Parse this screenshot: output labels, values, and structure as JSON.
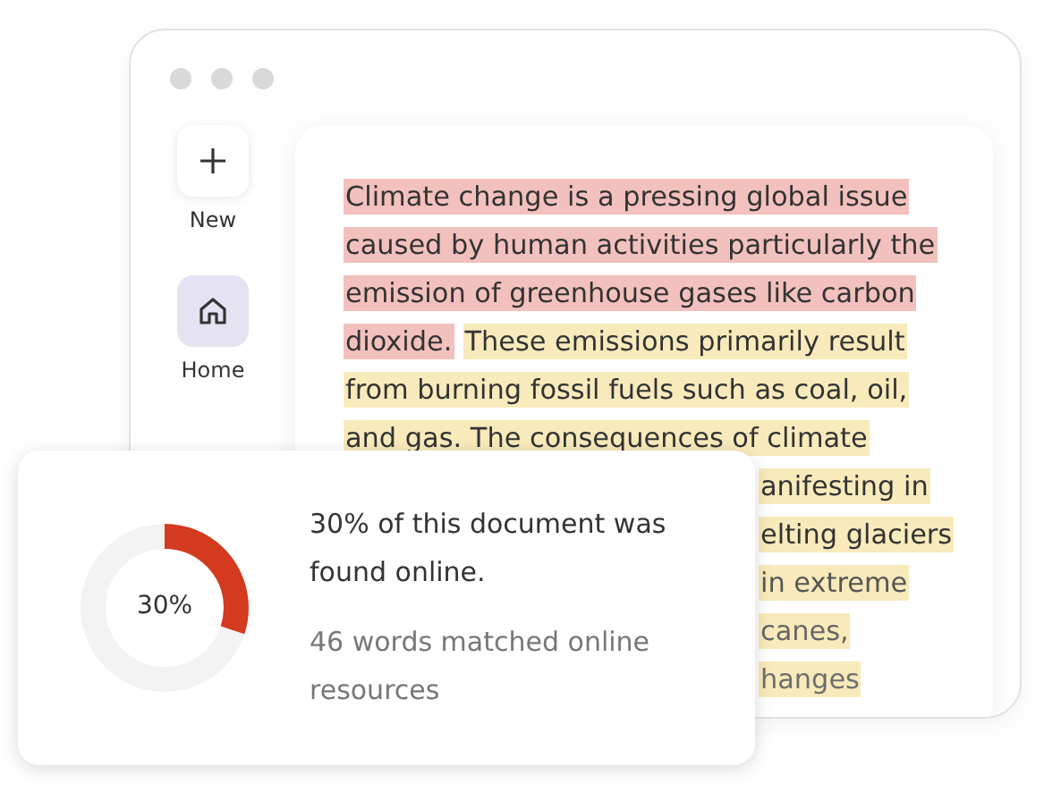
{
  "sidebar": {
    "items": [
      {
        "kind": "new",
        "label": "New",
        "selected": false
      },
      {
        "kind": "home",
        "label": "Home",
        "selected": true
      }
    ]
  },
  "document": {
    "lines": [
      {
        "segments": [
          {
            "text": "Climate change is a pressing global issue",
            "color": "#f3c1bd"
          }
        ],
        "covered": false
      },
      {
        "segments": [
          {
            "text": "caused by human activities particularly the",
            "color": "#f3c1bd"
          }
        ],
        "covered": false
      },
      {
        "segments": [
          {
            "text": "emission of greenhouse gases like carbon",
            "color": "#f3c1bd"
          }
        ],
        "covered": false
      },
      {
        "segments": [
          {
            "text": "dioxide.",
            "color": "#f3c1bd"
          },
          {
            "text": "These emissions primarily result",
            "color": "#f8eabb"
          }
        ],
        "covered": false
      },
      {
        "segments": [
          {
            "text": "from burning fossil fuels such as coal, oil,",
            "color": "#f8eabb"
          }
        ],
        "covered": false
      },
      {
        "segments": [
          {
            "text": "and gas. The consequences of climate",
            "color": "#f8eabb"
          }
        ],
        "covered": false
      },
      {
        "segments": [
          {
            "text": "anifesting in",
            "color": "#f8eabb"
          }
        ],
        "covered": true
      },
      {
        "segments": [
          {
            "text": "elting glaciers",
            "color": "#f8eabb"
          }
        ],
        "covered": true
      },
      {
        "segments": [
          {
            "text": "in extreme",
            "color": "#f8eabb"
          }
        ],
        "covered": true
      },
      {
        "segments": [
          {
            "text": "canes,",
            "color": "#f8eabb"
          }
        ],
        "covered": true
      },
      {
        "segments": [
          {
            "text": "hanges",
            "color": "#f8eabb"
          }
        ],
        "covered": true
      }
    ]
  },
  "result": {
    "level": 0.3,
    "percent": "30%",
    "summary": "30% of this document was found online.",
    "detail": "46 words matched online resources"
  }
}
